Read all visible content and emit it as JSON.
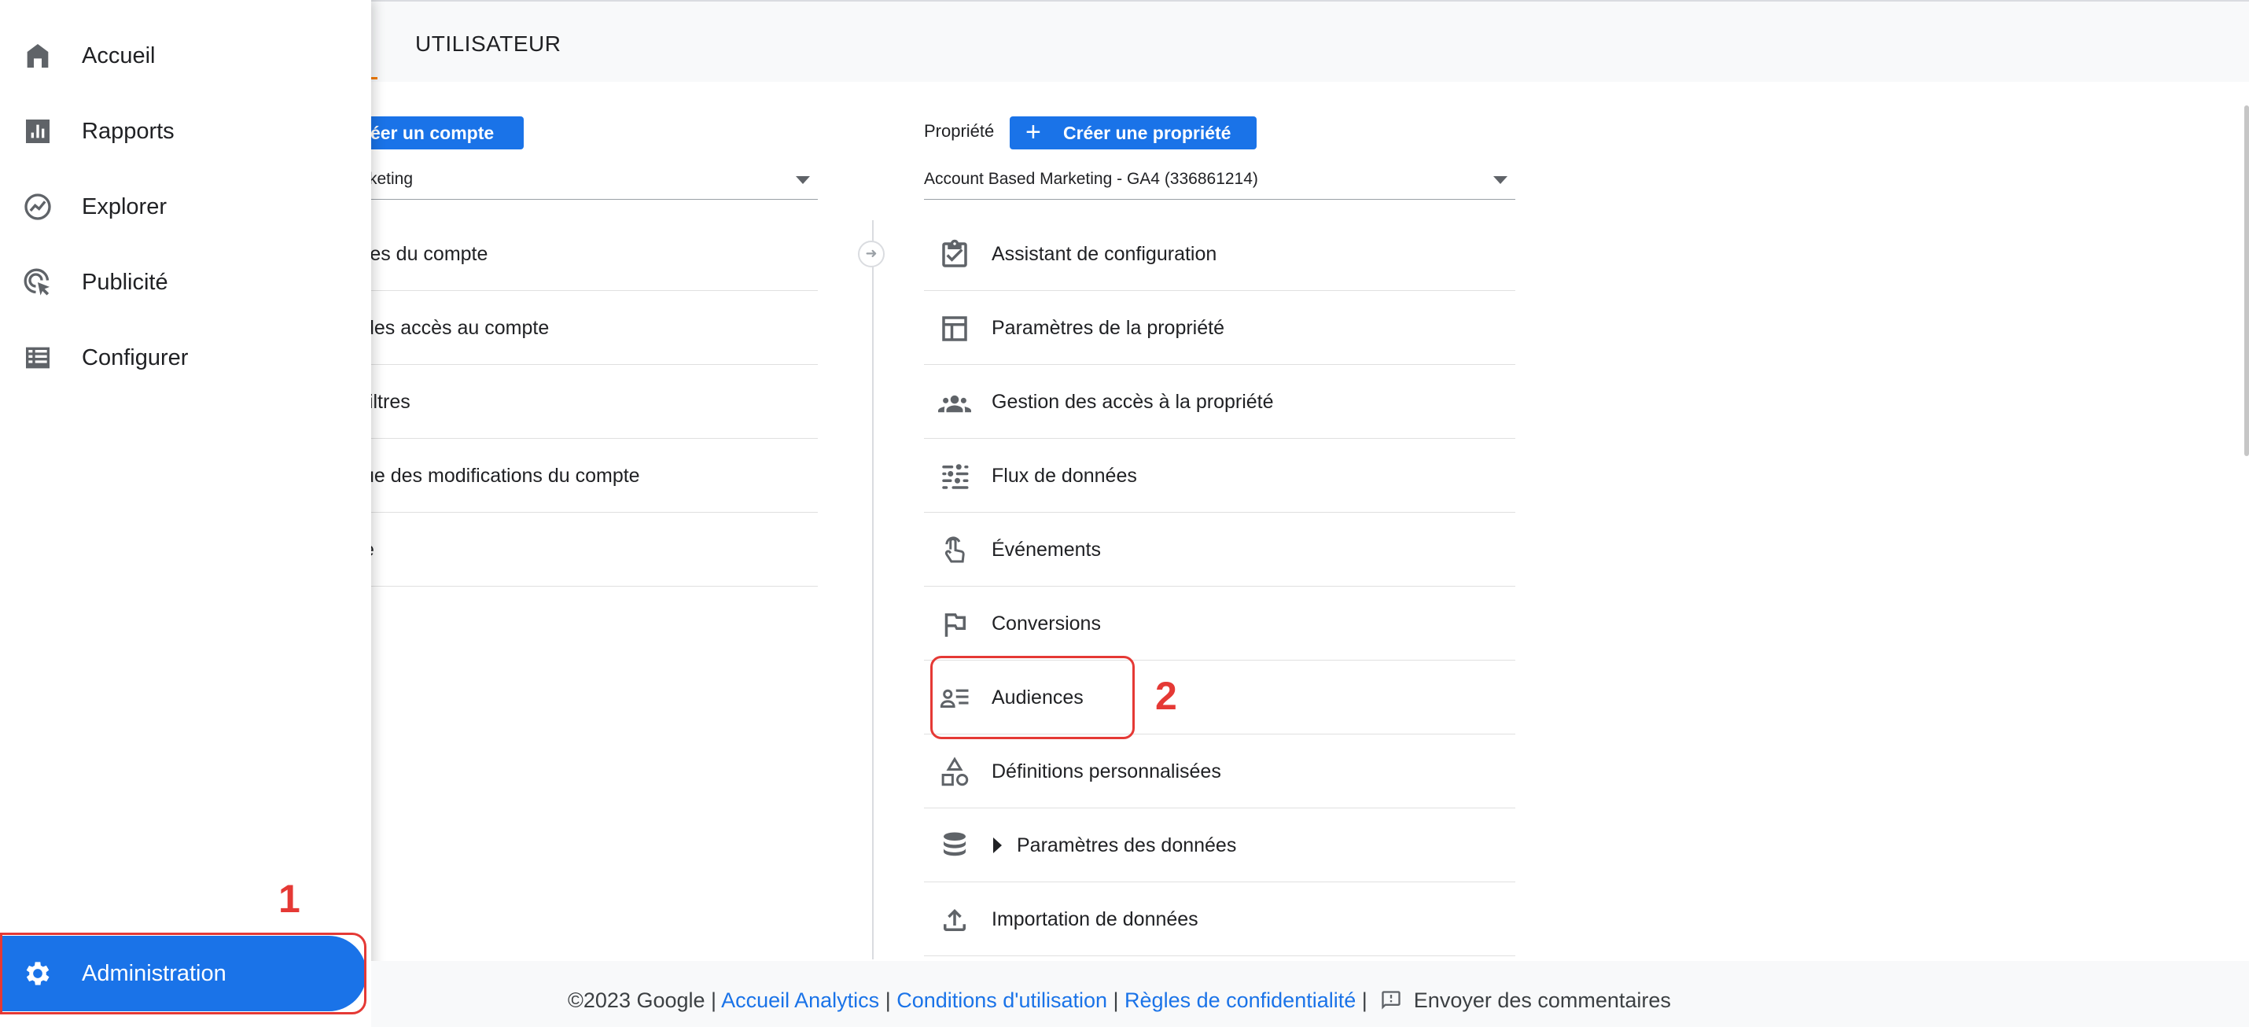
{
  "header": {
    "title": "UTILISATEUR"
  },
  "sidebar": {
    "items": [
      {
        "label": "Accueil",
        "icon": "home-icon"
      },
      {
        "label": "Rapports",
        "icon": "bar-chart-icon"
      },
      {
        "label": "Explorer",
        "icon": "explore-icon"
      },
      {
        "label": "Publicité",
        "icon": "ads-cursor-icon"
      },
      {
        "label": "Configurer",
        "icon": "list-icon"
      }
    ],
    "admin": {
      "label": "Administration",
      "icon": "gear-icon",
      "active": true
    }
  },
  "account": {
    "create_button": "réer un compte",
    "selected": "rketing",
    "items": [
      "res du compte",
      "des accès au compte",
      " filtres",
      "ue des modifications du compte",
      "e"
    ]
  },
  "property": {
    "label": "Propriété",
    "create_button": "Créer une propriété",
    "selected": "Account Based Marketing  - GA4 (336861214)",
    "items": [
      {
        "label": "Assistant de configuration",
        "icon": "checklist-icon"
      },
      {
        "label": "Paramètres de la propriété",
        "icon": "layout-icon"
      },
      {
        "label": "Gestion des accès à la propriété",
        "icon": "people-icon"
      },
      {
        "label": "Flux de données",
        "icon": "streams-icon"
      },
      {
        "label": "Événements",
        "icon": "touch-icon"
      },
      {
        "label": "Conversions",
        "icon": "flag-icon"
      },
      {
        "label": "Audiences",
        "icon": "audience-icon"
      },
      {
        "label": "Définitions personnalisées",
        "icon": "shapes-icon"
      },
      {
        "label": "Paramètres des données",
        "icon": "database-icon",
        "expandable": true
      },
      {
        "label": "Importation de données",
        "icon": "upload-icon"
      }
    ]
  },
  "annotations": {
    "step1": "1",
    "step2": "2"
  },
  "footer": {
    "copyright": "©2023 Google",
    "links": [
      "Accueil Analytics",
      "Conditions d'utilisation",
      "Règles de confidentialité"
    ],
    "feedback": "Envoyer des commentaires"
  },
  "colors": {
    "accent": "#1a73e8",
    "annotation": "#e53935"
  }
}
